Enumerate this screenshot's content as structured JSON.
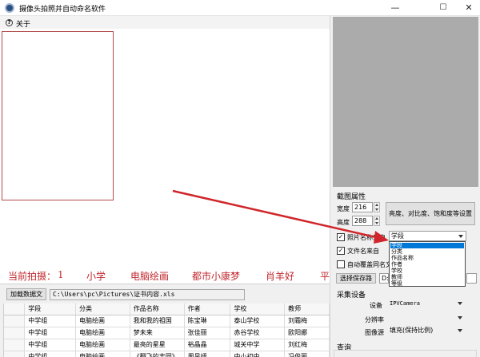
{
  "window": {
    "title": "摄像头拍照并自动命名软件",
    "controls": {
      "minimize": "—",
      "maximize": "☐",
      "close": "✕"
    }
  },
  "menu": {
    "help_icon": "?",
    "about": "关于"
  },
  "status": {
    "prefix": "当前拍摄：",
    "number": "1",
    "stage": "小学",
    "category": "电脑绘画",
    "title": "都市小康梦",
    "author": "肖羊好",
    "truncated": "平"
  },
  "data_load": {
    "button": "加载数据文",
    "path": "C:\\Users\\pc\\Pictures\\证书内容.xls"
  },
  "table": {
    "columns": [
      "学段",
      "分类",
      "作品名称",
      "作者",
      "学校",
      "教师"
    ],
    "rows": [
      [
        "中学组",
        "电脑绘画",
        "我和我的祖国",
        "陈宝琳",
        "泰山学校",
        "刘霜梅"
      ],
      [
        "中学组",
        "电脑绘画",
        "梦未来",
        "张佳丽",
        "赤谷学校",
        "欧阳娜"
      ],
      [
        "中学组",
        "电脑绘画",
        "最亮的星星",
        "裕晶晶",
        "城关中学",
        "刘红梅"
      ],
      [
        "中学组",
        "电脑绘画",
        "《翻飞的丰园》",
        "周昊妍",
        "中小初中",
        "冯俊丽"
      ]
    ]
  },
  "image_props": {
    "section": "截图属性",
    "width_label": "宽度",
    "width_value": "216",
    "height_label": "高度",
    "height_value": "288",
    "adjust_button": "亮度、对比度、饱和度等设置"
  },
  "naming": {
    "photo_name_from": "照片名称来自",
    "photo_name_checked": true,
    "photo_name_value": "学段",
    "file_name_from": "文件名来自",
    "file_name_checked": true,
    "auto_overwrite": "自动覆盖同名文",
    "auto_overwrite_checked": false,
    "save_dir_button": "选择保存路",
    "save_dir_value": "D:\\",
    "dropdown_options": [
      "学段",
      "分类",
      "作品名称",
      "作者",
      "学校",
      "教师",
      "等级"
    ],
    "dropdown_selected": "学段"
  },
  "capture": {
    "section": "采集设备",
    "device_label": "设备",
    "device_value": "IPVCamera",
    "resolution_label": "分辨率",
    "resolution_value": "",
    "image_source_label": "图像源",
    "image_source_value": "填充(保持比例)"
  },
  "query": {
    "section": "查询"
  },
  "colors": {
    "status_red": "#c0282e",
    "arrow_red": "#d0262b",
    "selection_blue": "#0078d7",
    "preview_gray": "#ababab",
    "frame_red": "#b34a4a"
  }
}
